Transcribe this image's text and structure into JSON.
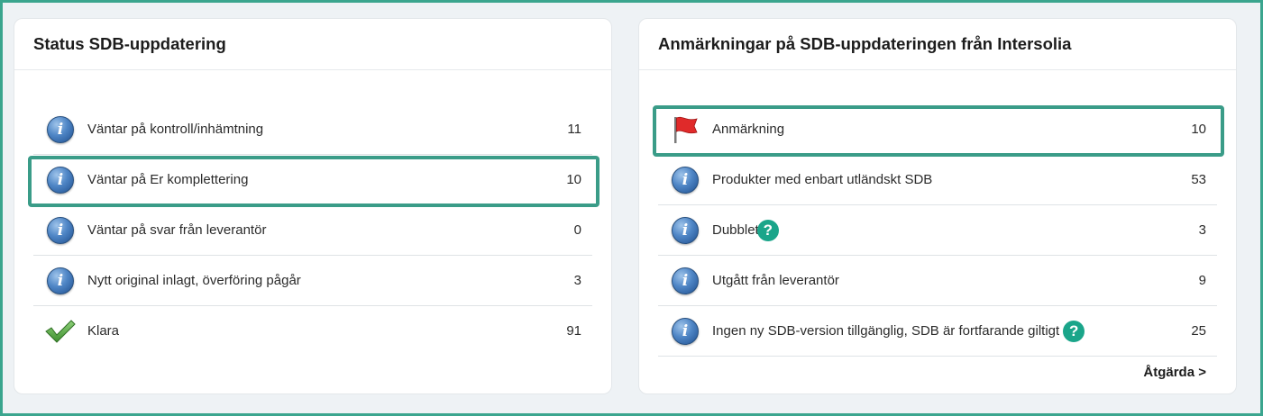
{
  "status_card": {
    "title": "Status SDB-uppdatering",
    "rows": [
      {
        "icon": "info-icon",
        "label": "Väntar på kontroll/inhämtning",
        "count": "11"
      },
      {
        "icon": "info-icon",
        "label": "Väntar på Er komplettering",
        "count": "10",
        "highlighted": true
      },
      {
        "icon": "info-icon",
        "label": "Väntar på svar från leverantör",
        "count": "0"
      },
      {
        "icon": "info-icon",
        "label": "Nytt original inlagt, överföring pågår",
        "count": "3"
      },
      {
        "icon": "checkmark-icon",
        "label": "Klara",
        "count": "91"
      }
    ]
  },
  "remarks_card": {
    "title": "Anmärkningar på SDB-uppdateringen från Intersolia",
    "rows": [
      {
        "icon": "flag-icon",
        "label": "Anmärkning",
        "count": "10",
        "highlighted": true
      },
      {
        "icon": "info-icon",
        "label": "Produkter med enbart utländskt SDB",
        "count": "53"
      },
      {
        "icon": "info-icon",
        "label": "Dubblett",
        "count": "3",
        "help": "?"
      },
      {
        "icon": "info-icon",
        "label": "Utgått från leverantör",
        "count": "9"
      },
      {
        "icon": "info-icon",
        "label": "Ingen ny SDB-version tillgänglig, SDB är fortfarande giltigt",
        "count": "25",
        "help": "?"
      }
    ],
    "action_label": "Åtgärda >"
  },
  "colors": {
    "highlight_border": "#3a9c88",
    "help_badge": "#1aa58a",
    "frame_border": "#3aa58e"
  }
}
